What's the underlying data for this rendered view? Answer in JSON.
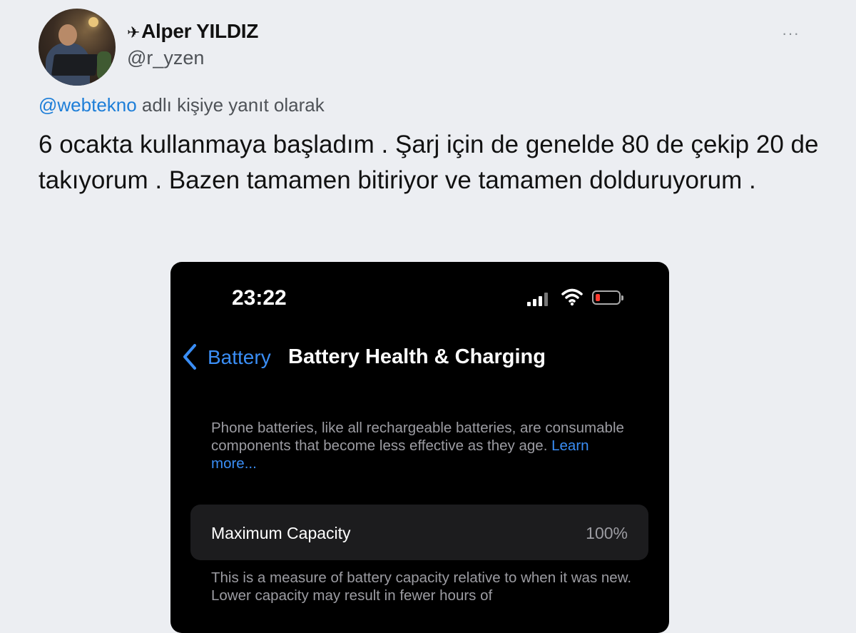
{
  "tweet": {
    "display_name": "Alper YILDIZ",
    "name_prefix_icon": "✈",
    "handle": "@r_yzen",
    "more_icon": "···",
    "reply_to": "@webtekno",
    "reply_suffix": " adlı kişiye yanıt olarak",
    "text": "6 ocakta kullanmaya başladım . Şarj için de genelde 80 de çekip 20 de takıyorum . Bazen tamamen bitiriyor ve tamamen dolduruyorum ."
  },
  "phone": {
    "time": "23:22",
    "battery_level": 0.2,
    "battery_color": "#ff3b30",
    "accent": "#3a8ef6",
    "back_label": "Battery",
    "title": "Battery Health & Charging",
    "description": "Phone batteries, like all rechargeable batteries, are consumable components that become less effective as they age.",
    "learn_more": "Learn more...",
    "capacity_label": "Maximum Capacity",
    "capacity_value": "100%",
    "capacity_note": "This is a measure of battery capacity relative to when it was new. Lower capacity may result in fewer hours of"
  }
}
